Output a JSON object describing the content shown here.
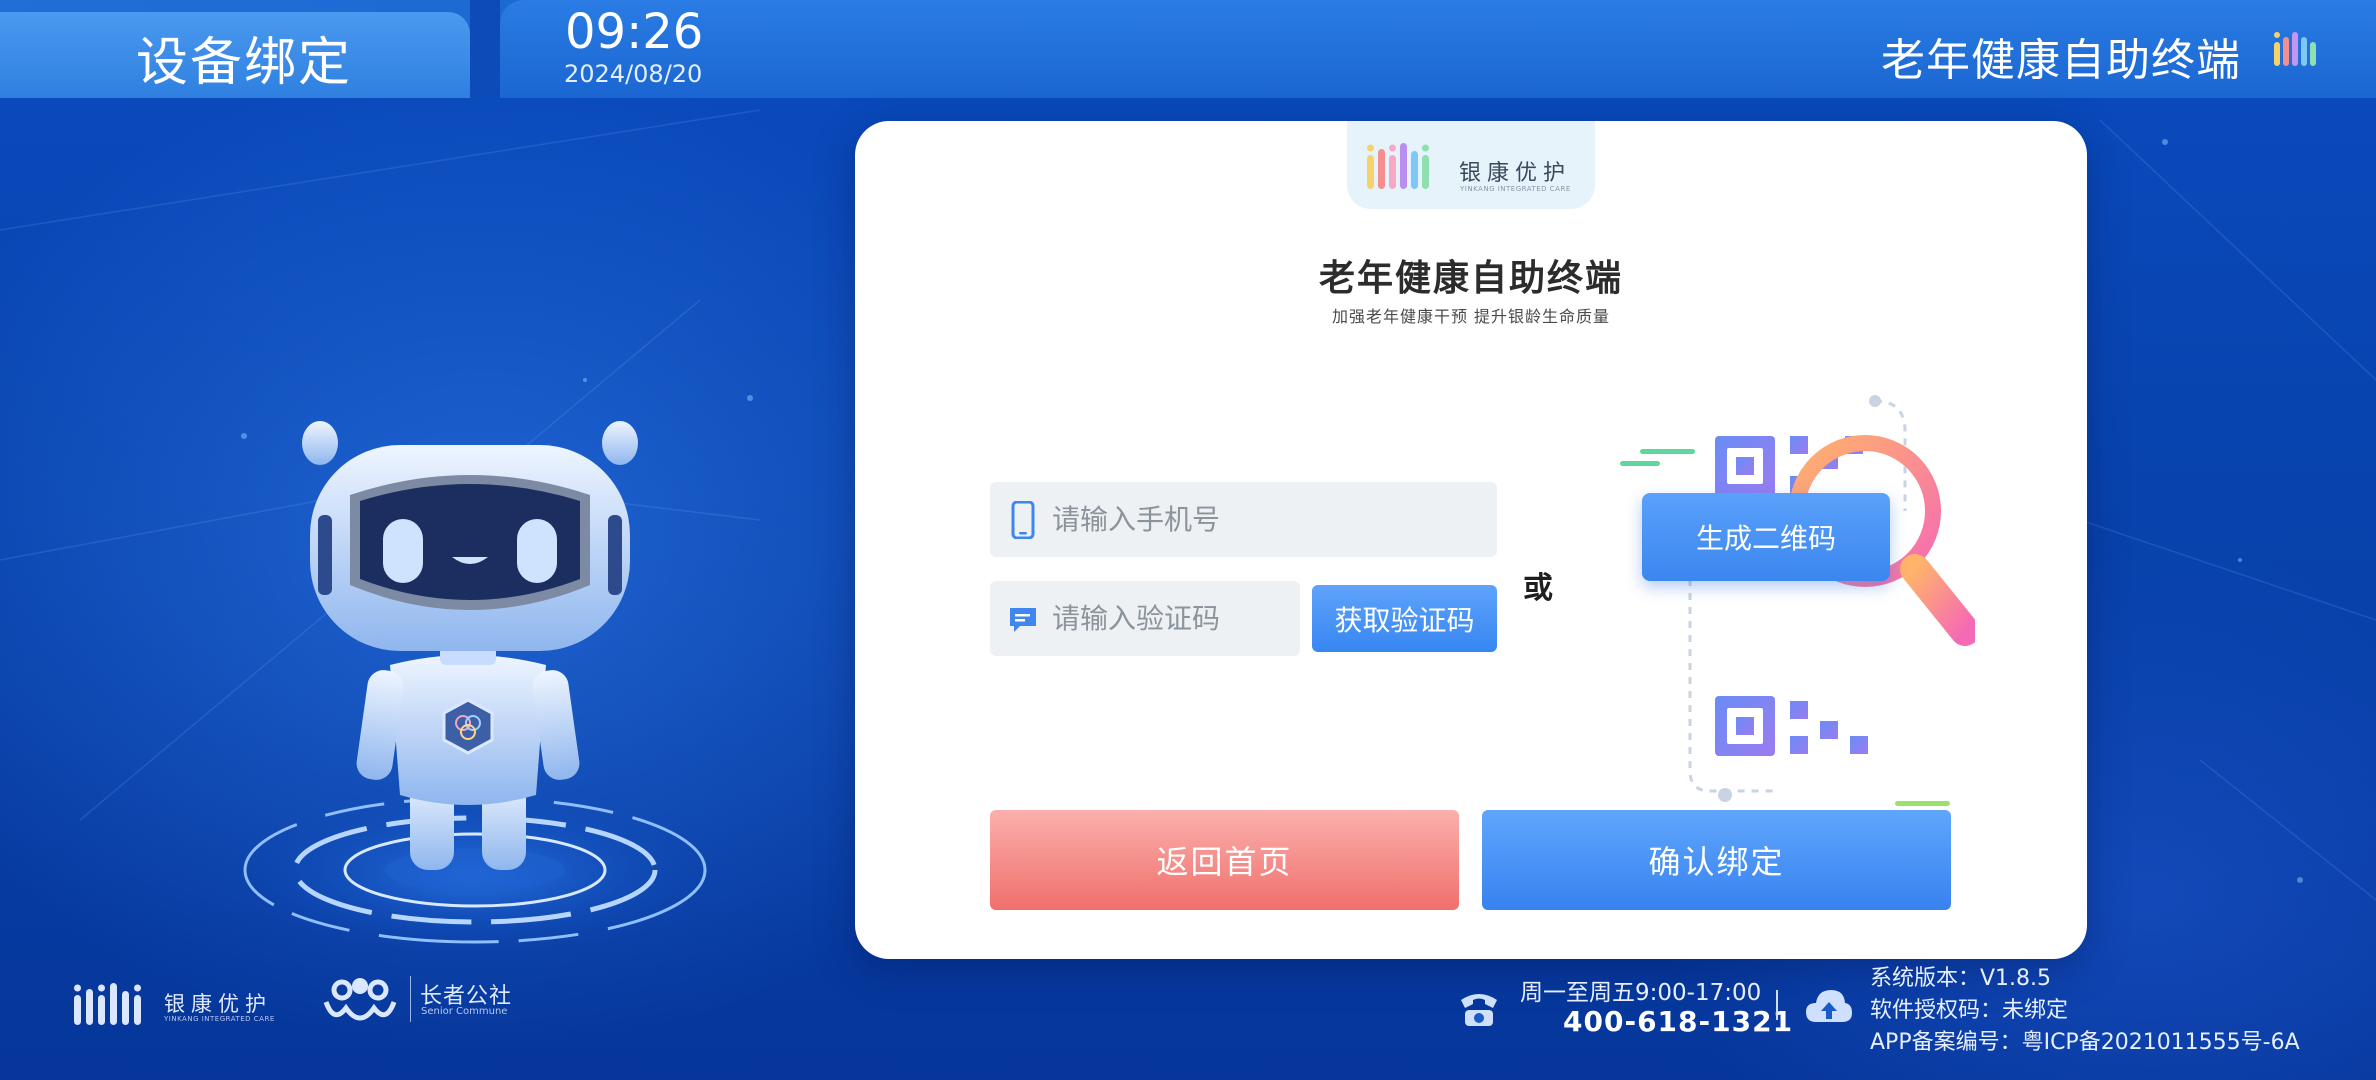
{
  "header": {
    "page_title": "设备绑定",
    "time": "09:26",
    "date": "2024/08/20",
    "app_name": "老年健康自助终端",
    "logo_icon": "brand-bars-icon"
  },
  "card": {
    "brand_name": "银康优护",
    "brand_sub": "YINKANG INTEGRATED CARE",
    "title": "老年健康自助终端",
    "subtitle": "加强老年健康干预 提升银龄生命质量",
    "phone_placeholder": "请输入手机号",
    "code_placeholder": "请输入验证码",
    "get_code_label": "获取验证码",
    "or_label": "或",
    "qr_button_label": "生成二维码",
    "back_label": "返回首页",
    "confirm_label": "确认绑定"
  },
  "footer": {
    "brand1": "银康优护",
    "brand1_sub": "YINKANG INTEGRATED CARE",
    "brand2": "长者公社",
    "brand2_sub": "Senior Commune",
    "hours": "周一至周五9:00-17:00",
    "hotline": "400-618-1321",
    "system_version": "系统版本：V1.8.5",
    "license_code": "软件授权码：未绑定",
    "app_record": "APP备案编号：粤ICP备2021011555号-6A"
  },
  "colors": {
    "background": "#0843ad",
    "header": "#1b66d2",
    "primary_button": "#3786f2",
    "back_button": "#f06f6b"
  }
}
